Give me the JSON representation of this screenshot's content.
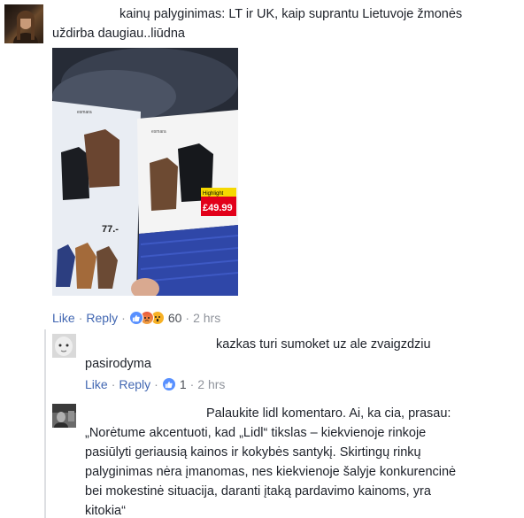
{
  "comments": [
    {
      "text_line1": "kainų palyginimas: LT ir UK, kaip suprantu Lietuvoje žmonės",
      "text_line2": "uždirba daugiau..liūdna",
      "actions": {
        "like": "Like",
        "reply": "Reply",
        "reaction_count": "60",
        "time": "2 hrs",
        "reactions": [
          "like-icon",
          "angry-icon",
          "wow-icon"
        ]
      },
      "photo": {
        "left_price": "77.-",
        "right_badge": "Highlight",
        "right_price": "£49.99"
      }
    }
  ],
  "replies": [
    {
      "text_line1": "kazkas turi sumoket uz ale zvaigzdziu",
      "text_line2": "pasirodyma",
      "actions": {
        "like": "Like",
        "reply": "Reply",
        "reaction_count": "1",
        "time": "2 hrs",
        "reactions": [
          "like-icon"
        ]
      }
    },
    {
      "text_lines": [
        "Palaukite lidl komentaro. Ai, ka cia, prasau:",
        "„Norėtume akcentuoti, kad „Lidl“ tikslas – kiekvienoje rinkoje",
        "pasiūlyti geriausią kainos ir kokybės santykį. Skirtingų rinkų",
        "palyginimas nėra įmanomas, nes kiekvienoje šalyje konkurencinė",
        "bei mokestinė situacija, daranti įtaką pardavimo kainoms, yra",
        "kitokia“"
      ]
    }
  ],
  "colors": {
    "link": "#4267b2",
    "meta": "#90949c",
    "text": "#1d2129",
    "like_blue": "#5890ff",
    "angry": "#f0a340",
    "wow": "#f7b125"
  }
}
